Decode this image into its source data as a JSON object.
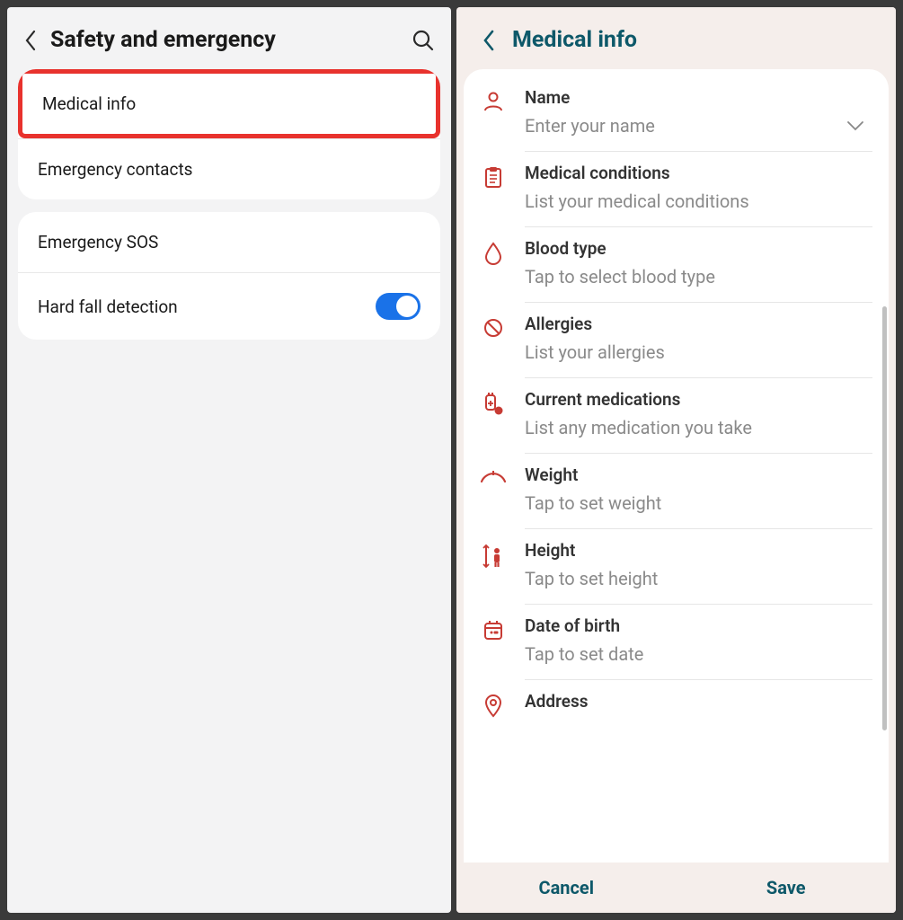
{
  "left": {
    "title": "Safety and emergency",
    "group1": {
      "medical_info": "Medical info",
      "emergency_contacts": "Emergency contacts"
    },
    "group2": {
      "emergency_sos": "Emergency SOS",
      "hard_fall": "Hard fall detection",
      "hard_fall_on": true
    }
  },
  "right": {
    "title": "Medical info",
    "fields": {
      "name": {
        "label": "Name",
        "placeholder": "Enter your name"
      },
      "conditions": {
        "label": "Medical conditions",
        "placeholder": "List your medical conditions"
      },
      "blood": {
        "label": "Blood type",
        "placeholder": "Tap to select blood type"
      },
      "allergies": {
        "label": "Allergies",
        "placeholder": "List your allergies"
      },
      "medications": {
        "label": "Current medications",
        "placeholder": "List any medication you take"
      },
      "weight": {
        "label": "Weight",
        "placeholder": "Tap to set weight"
      },
      "height": {
        "label": "Height",
        "placeholder": "Tap to set height"
      },
      "dob": {
        "label": "Date of birth",
        "placeholder": "Tap to set date"
      },
      "address": {
        "label": "Address"
      }
    },
    "cancel": "Cancel",
    "save": "Save"
  }
}
